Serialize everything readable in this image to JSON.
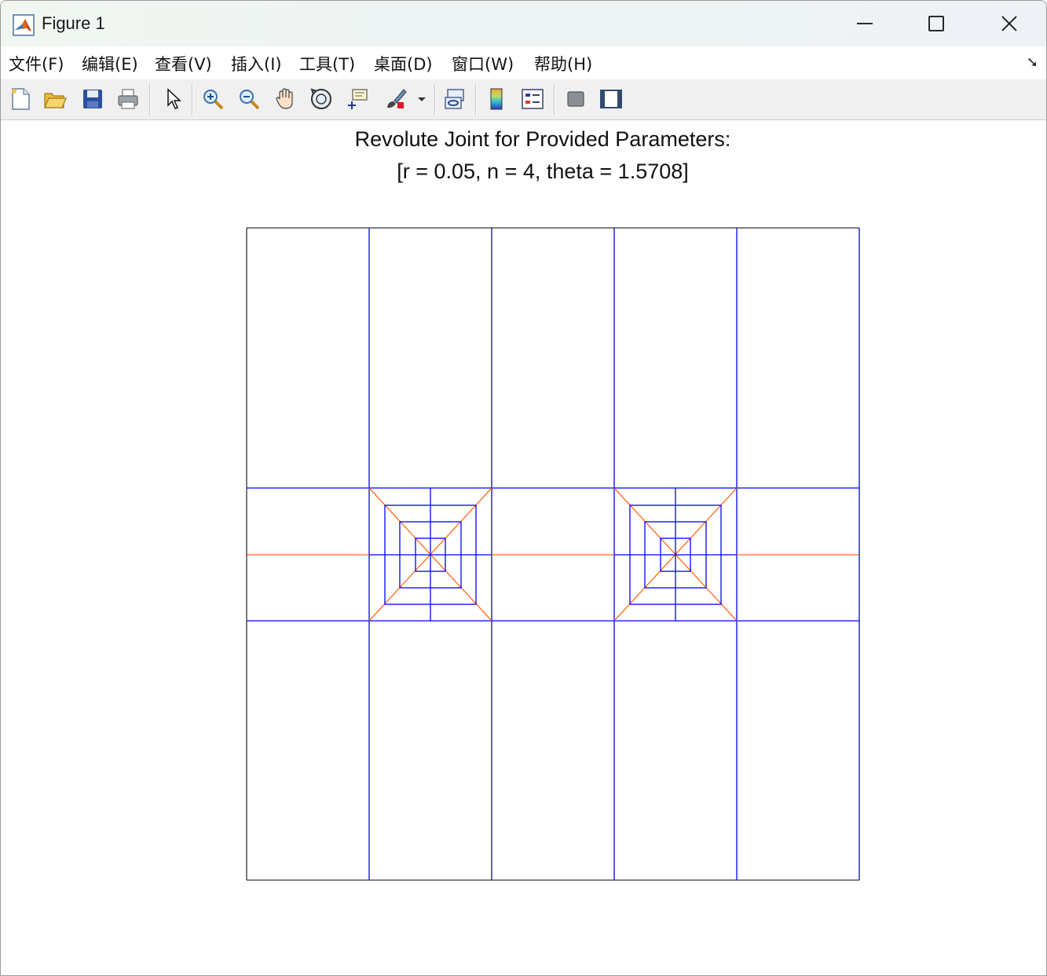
{
  "window": {
    "title": "Figure 1",
    "controls": [
      "minimize",
      "maximize",
      "close"
    ]
  },
  "menu": {
    "items": [
      {
        "label": "文件(F)"
      },
      {
        "label": "编辑(E)"
      },
      {
        "label": "查看(V)"
      },
      {
        "label": "插入(I)"
      },
      {
        "label": "工具(T)"
      },
      {
        "label": "桌面(D)"
      },
      {
        "label": "窗口(W)"
      },
      {
        "label": "帮助(H)"
      }
    ],
    "overflow_icon": "dock-arrow-icon"
  },
  "toolbar": {
    "icons": [
      "new-figure-icon",
      "open-file-icon",
      "save-icon",
      "print-icon",
      "pointer-icon",
      "zoom-in-icon",
      "zoom-out-icon",
      "pan-hand-icon",
      "rotate-3d-icon",
      "data-cursor-icon",
      "brush-icon",
      "brush-dropdown-icon",
      "link-plot-icon",
      "colorbar-icon",
      "legend-icon",
      "hide-plot-tools-icon",
      "show-plot-tools-icon"
    ]
  },
  "figure": {
    "title_line1": "Revolute Joint for Provided Parameters:",
    "title_line2": "[r = 0.05, n = 4, theta = 1.5708]"
  },
  "colors": {
    "mesh": "#0000ff",
    "crease": "#ff6a1a",
    "axes": "#333333"
  }
}
